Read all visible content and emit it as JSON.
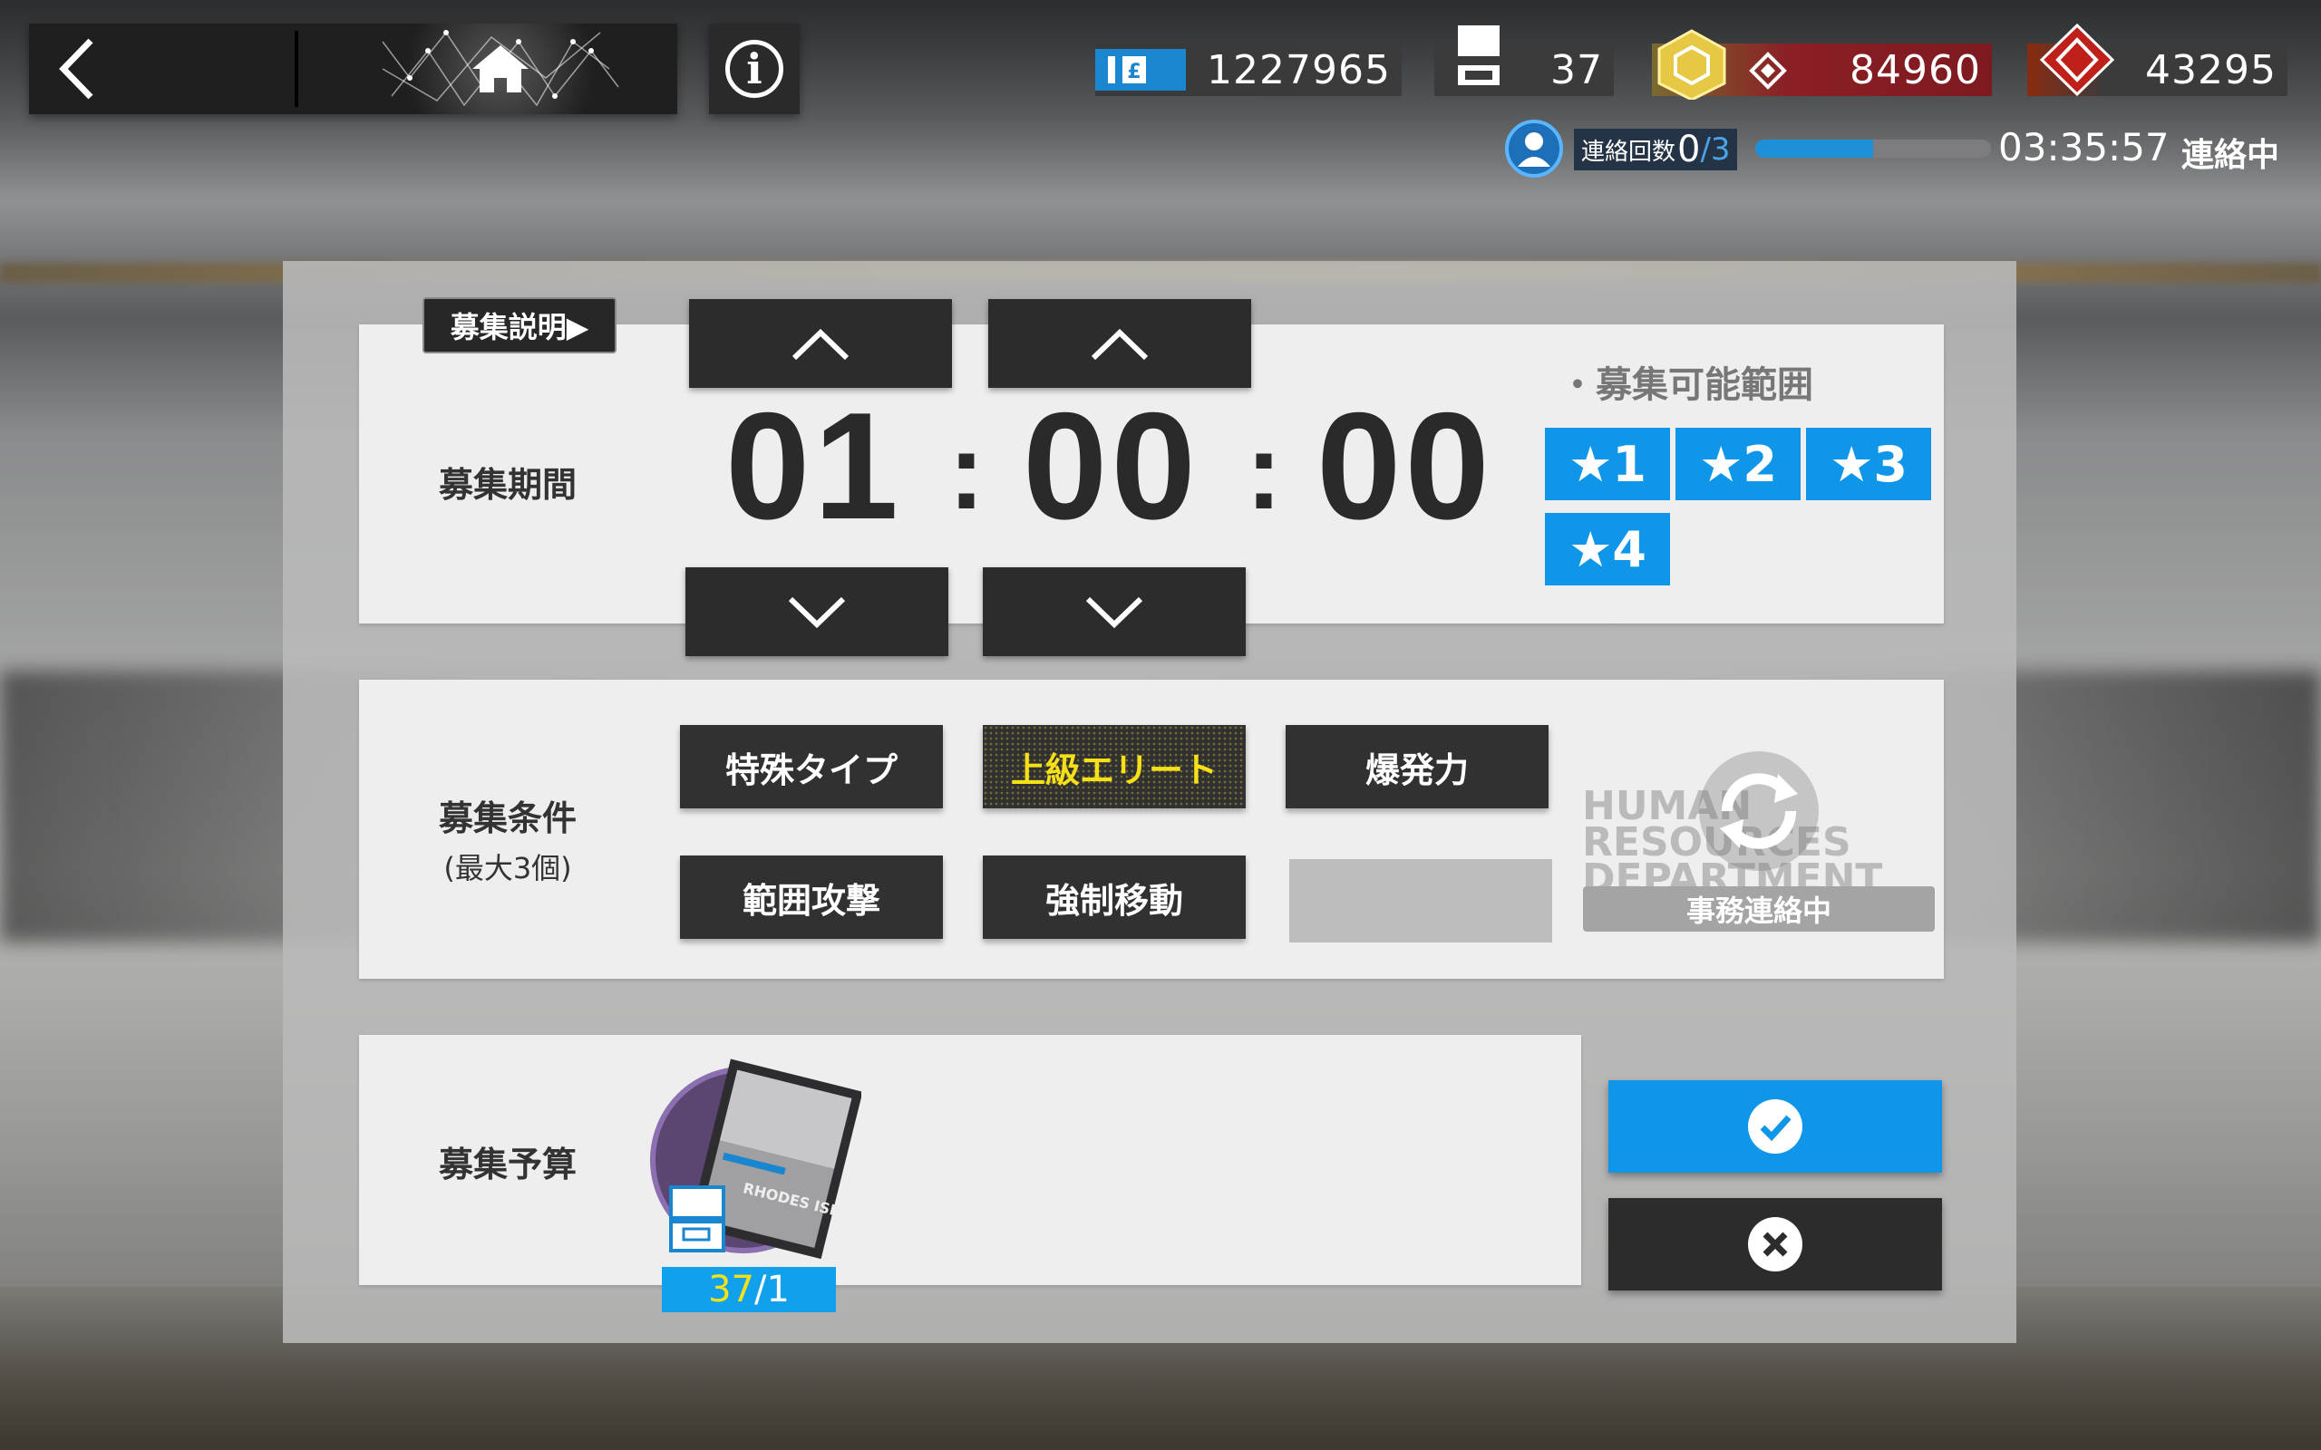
{
  "topbar": {
    "back_icon": "chevron-left-icon",
    "home_icon": "home-icon",
    "info_label": "i"
  },
  "resources": [
    {
      "name": "lmd-icon",
      "value": "1227965"
    },
    {
      "name": "recruitment-permit-icon",
      "value": "37"
    },
    {
      "name": "orundum-icon",
      "value": "84960"
    },
    {
      "name": "originium-icon",
      "value": "43295"
    }
  ],
  "contact": {
    "label": "連絡回数",
    "current": "0",
    "max": "/3",
    "progress_fraction": 0.5,
    "timer": "03:35:57",
    "status": "連絡中"
  },
  "recruit": {
    "explain_button": "募集説明▶",
    "period_label": "募集期間",
    "time": {
      "hours": "01",
      "minutes": "00",
      "seconds": "00",
      "colon": ":"
    },
    "range_title": "・募集可能範囲",
    "stars": [
      "★1",
      "★2",
      "★3",
      "★4"
    ],
    "conditions_label": "募集条件",
    "conditions_sub": "(最大3個)",
    "tags": [
      {
        "label": "特殊タイプ",
        "selected": false
      },
      {
        "label": "上級エリート",
        "selected": true
      },
      {
        "label": "爆発力",
        "selected": false
      },
      {
        "label": "範囲攻撃",
        "selected": false
      },
      {
        "label": "強制移動",
        "selected": false
      }
    ],
    "hr_watermark": "HUMAN RESOURCES DEPARTMENT",
    "refresh_status": "事務連絡中",
    "budget_label": "募集予算",
    "budget_current": "37",
    "budget_required": "/1",
    "card_text": "RHODES ISLAND"
  },
  "colors": {
    "accent_blue": "#0f96e8",
    "selected_tag_text": "#f6e017",
    "button_dark": "#2c2c2d"
  }
}
